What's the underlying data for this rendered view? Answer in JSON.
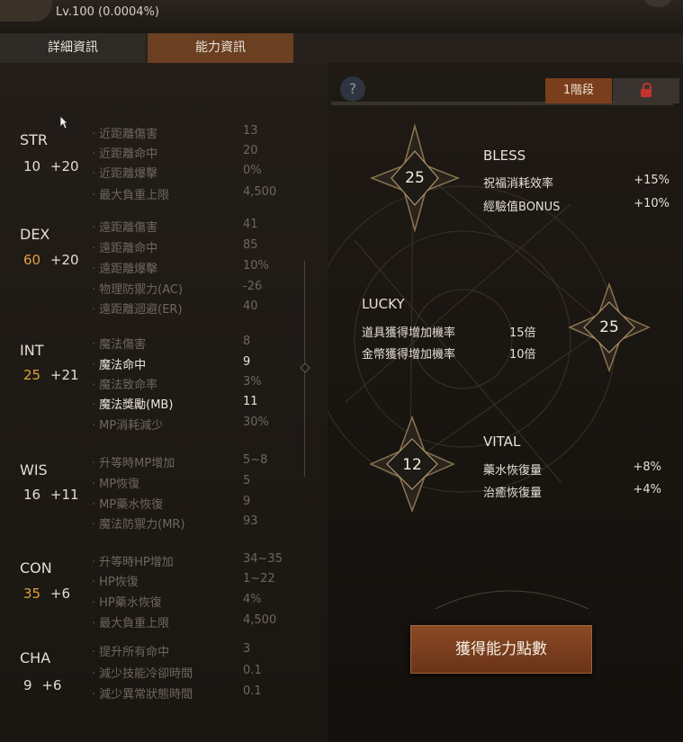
{
  "header": {
    "level_text": "Lv.100 (0.0004%)"
  },
  "tabs": [
    {
      "label": "詳細資訊"
    },
    {
      "label": "能力資訊"
    }
  ],
  "stats": [
    {
      "name": "STR",
      "base": "10",
      "bonus": "+20",
      "highlight": false,
      "rows": [
        {
          "label": "近距離傷害",
          "value": "13",
          "hl": false
        },
        {
          "label": "近距離命中",
          "value": "20",
          "hl": false
        },
        {
          "label": "近距離爆擊",
          "value": "0%",
          "hl": false
        },
        {
          "label": "最大負重上限",
          "value": "4,500",
          "hl": false
        }
      ]
    },
    {
      "name": "DEX",
      "base": "60",
      "bonus": "+20",
      "highlight": true,
      "rows": [
        {
          "label": "遠距離傷害",
          "value": "41",
          "hl": false
        },
        {
          "label": "遠距離命中",
          "value": "85",
          "hl": false
        },
        {
          "label": "遠距離爆擊",
          "value": "10%",
          "hl": false
        },
        {
          "label": "物理防禦力(AC)",
          "value": "-26",
          "hl": false
        },
        {
          "label": "遠距離迴避(ER)",
          "value": "40",
          "hl": false
        }
      ]
    },
    {
      "name": "INT",
      "base": "25",
      "bonus": "+21",
      "highlight": true,
      "rows": [
        {
          "label": "魔法傷害",
          "value": "8",
          "hl": false
        },
        {
          "label": "魔法命中",
          "value": "9",
          "hl": true
        },
        {
          "label": "魔法致命率",
          "value": "3%",
          "hl": false
        },
        {
          "label": "魔法獎勵(MB)",
          "value": "11",
          "hl": true
        },
        {
          "label": "MP消耗減少",
          "value": "30%",
          "hl": false
        }
      ]
    },
    {
      "name": "WIS",
      "base": "16",
      "bonus": "+11",
      "highlight": false,
      "rows": [
        {
          "label": "升等時MP增加",
          "value": "5~8",
          "hl": false
        },
        {
          "label": "MP恢復",
          "value": "5",
          "hl": false
        },
        {
          "label": "MP藥水恢復",
          "value": "9",
          "hl": false
        },
        {
          "label": "魔法防禦力(MR)",
          "value": "93",
          "hl": false
        }
      ]
    },
    {
      "name": "CON",
      "base": "35",
      "bonus": "+6",
      "highlight": true,
      "rows": [
        {
          "label": "升等時HP增加",
          "value": "34~35",
          "hl": false
        },
        {
          "label": "HP恢復",
          "value": "1~22",
          "hl": false
        },
        {
          "label": "HP藥水恢復",
          "value": "4%",
          "hl": false
        },
        {
          "label": "最大負重上限",
          "value": "4,500",
          "hl": false
        }
      ]
    },
    {
      "name": "CHA",
      "base": "9",
      "bonus": "+6",
      "highlight": false,
      "rows": [
        {
          "label": "提升所有命中",
          "value": "3",
          "hl": false
        },
        {
          "label": "減少技能冷卻時間",
          "value": "0.1",
          "hl": false
        },
        {
          "label": "減少異常狀態時間",
          "value": "0.1",
          "hl": false
        }
      ]
    }
  ],
  "ability": {
    "help_label": "?",
    "stage_label": "1階段",
    "bless": {
      "title": "BLESS",
      "points": "25",
      "rows": [
        {
          "label": "祝福消耗效率",
          "value": "+15%"
        },
        {
          "label": "經驗值BONUS",
          "value": "+10%"
        }
      ]
    },
    "lucky": {
      "title": "LUCKY",
      "points": "25",
      "rows": [
        {
          "label": "道具獲得增加機率",
          "value": "15倍"
        },
        {
          "label": "金幣獲得增加機率",
          "value": "10倍"
        }
      ]
    },
    "vital": {
      "title": "VITAL",
      "points": "12",
      "rows": [
        {
          "label": "藥水恢復量",
          "value": "+8%"
        },
        {
          "label": "治癒恢復量",
          "value": "+4%"
        }
      ]
    },
    "get_button": "獲得能力點數"
  }
}
